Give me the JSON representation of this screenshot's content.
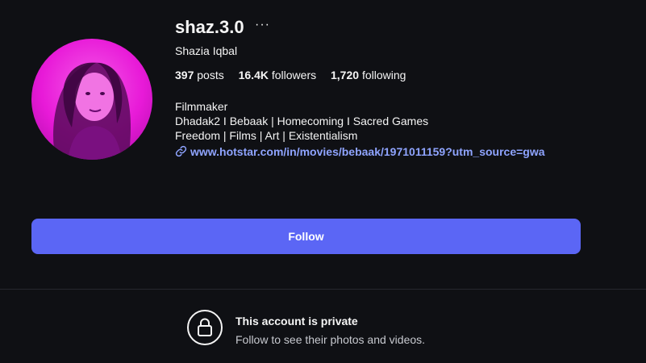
{
  "profile": {
    "username": "shaz.3.0",
    "more_label": "···",
    "full_name": "Shazia Iqbal",
    "stats": {
      "posts_count": "397",
      "posts_label": "posts",
      "followers_count": "16.4K",
      "followers_label": "followers",
      "following_count": "1,720",
      "following_label": "following"
    },
    "bio_lines": [
      "Filmmaker",
      "Dhadak2 I Bebaak | Homecoming I Sacred Games",
      "Freedom | Films | Art | Existentialism"
    ],
    "link": "www.hotstar.com/in/movies/bebaak/1971011159?utm_source=gwa"
  },
  "actions": {
    "follow_label": "Follow"
  },
  "private_notice": {
    "title": "This account is private",
    "subtitle": "Follow to see their photos and videos."
  },
  "icons": {
    "avatar": "profile-photo",
    "link": "link-icon",
    "lock": "lock-icon"
  },
  "colors": {
    "background": "#0f1014",
    "follow_button": "#5b66f5",
    "link": "#8fa4ff",
    "avatar_tint": "#e81ad8"
  }
}
